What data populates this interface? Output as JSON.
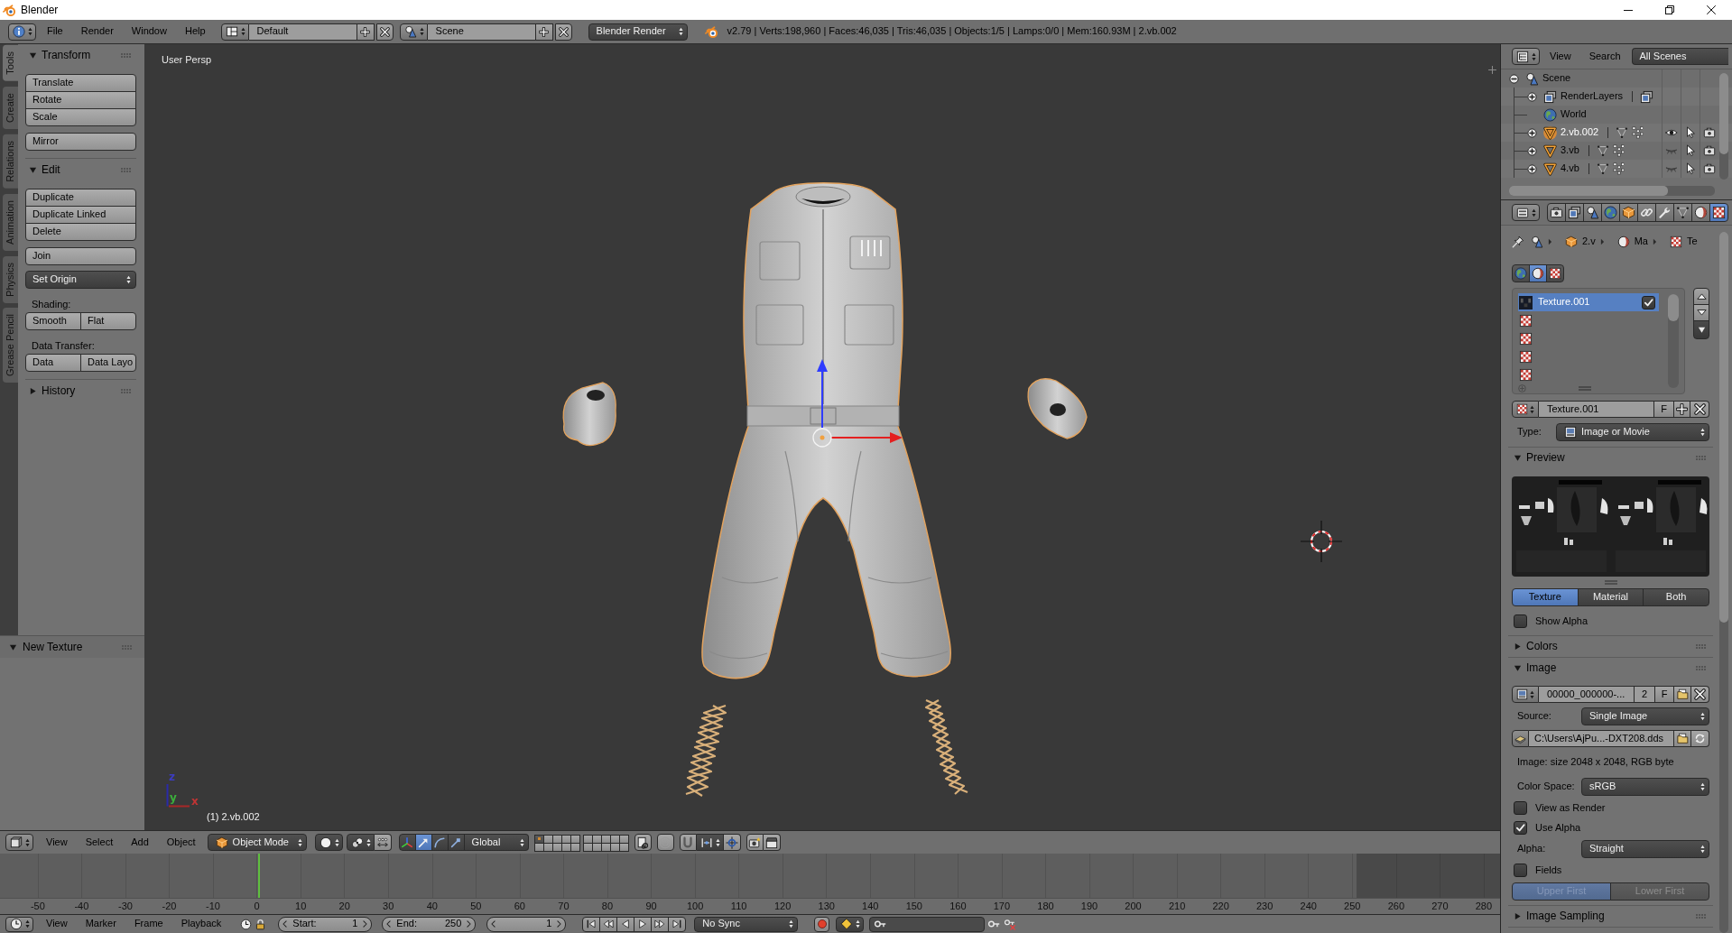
{
  "title_bar": {
    "title": "Blender"
  },
  "info_header": {
    "menus": [
      "File",
      "Render",
      "Window",
      "Help"
    ],
    "layout": "Default",
    "scene": "Scene",
    "engine": "Blender Render",
    "stats": "v2.79 | Verts:198,960 | Faces:46,035 | Tris:46,035 | Objects:1/5 | Lamps:0/0 | Mem:160.93M | 2.vb.002"
  },
  "tool_tabs": [
    {
      "label": "Tools",
      "selected": true
    },
    {
      "label": "Create",
      "selected": false
    },
    {
      "label": "Relations",
      "selected": false
    },
    {
      "label": "Animation",
      "selected": false
    },
    {
      "label": "Physics",
      "selected": false
    },
    {
      "label": "Grease Pencil",
      "selected": false
    }
  ],
  "tool_panels": [
    {
      "title": "Transform",
      "expanded": true,
      "items": [
        {
          "kind": "stack",
          "buttons": [
            "Translate",
            "Rotate",
            "Scale"
          ]
        },
        {
          "kind": "button",
          "label": "Mirror"
        }
      ]
    },
    {
      "title": "Edit",
      "expanded": true,
      "items": [
        {
          "kind": "stack",
          "buttons": [
            "Duplicate",
            "Duplicate Linked",
            "Delete"
          ]
        },
        {
          "kind": "button",
          "label": "Join"
        },
        {
          "kind": "dropdown",
          "label": "Set Origin"
        },
        {
          "kind": "label",
          "label": "Shading:"
        },
        {
          "kind": "row",
          "buttons": [
            "Smooth",
            "Flat"
          ]
        },
        {
          "kind": "label",
          "label": "Data Transfer:"
        },
        {
          "kind": "row",
          "buttons": [
            "Data",
            "Data Layo"
          ]
        }
      ]
    },
    {
      "title": "History",
      "expanded": false
    }
  ],
  "redo_panel": {
    "title": "New Texture",
    "expanded": true
  },
  "viewport": {
    "view_name": "User Persp",
    "object_info": "(1) 2.vb.002",
    "axis_labels": [
      {
        "label": "z",
        "color": "#3c3cc0"
      },
      {
        "label": "y",
        "color": "#3cb03c"
      },
      {
        "label": "x",
        "color": "#c03434"
      }
    ]
  },
  "view3d_header": {
    "menus": [
      "View",
      "Select",
      "Add",
      "Object"
    ],
    "mode": "Object Mode",
    "manipulators": [
      {
        "kind": "axes",
        "selected": false
      },
      {
        "kind": "translate",
        "selected": true
      },
      {
        "kind": "rotate",
        "selected": false
      },
      {
        "kind": "scale",
        "selected": false
      }
    ],
    "orientation": "Global",
    "layers": [
      {
        "selected": true,
        "has_objects": true
      },
      {
        "selected": false,
        "has_objects": false
      },
      {
        "selected": false,
        "has_objects": false
      },
      {
        "selected": false,
        "has_objects": false
      },
      {
        "selected": false,
        "has_objects": false
      },
      {
        "selected": false,
        "has_objects": false
      },
      {
        "selected": false,
        "has_objects": false
      },
      {
        "selected": false,
        "has_objects": false
      },
      {
        "selected": false,
        "has_objects": false
      },
      {
        "selected": false,
        "has_objects": false
      },
      {
        "selected": false,
        "has_objects": false
      },
      {
        "selected": false,
        "has_objects": false
      },
      {
        "selected": false,
        "has_objects": false
      },
      {
        "selected": false,
        "has_objects": false
      },
      {
        "selected": false,
        "has_objects": false
      },
      {
        "selected": false,
        "has_objects": false
      },
      {
        "selected": false,
        "has_objects": false
      },
      {
        "selected": false,
        "has_objects": false
      },
      {
        "selected": false,
        "has_objects": false
      },
      {
        "selected": false,
        "has_objects": false
      }
    ]
  },
  "timeline": {
    "ruler": [
      "-50",
      "-40",
      "-30",
      "-20",
      "-10",
      "0",
      "10",
      "20",
      "30",
      "40",
      "50",
      "60",
      "70",
      "80",
      "90",
      "100",
      "110",
      "120",
      "130",
      "140",
      "150",
      "160",
      "170",
      "180",
      "190",
      "200",
      "210",
      "220",
      "230",
      "240",
      "250",
      "260",
      "270",
      "280"
    ]
  },
  "timeline_header": {
    "menus": [
      "View",
      "Marker",
      "Frame",
      "Playback"
    ],
    "start_label": "Start:",
    "start": "1",
    "end_label": "End:",
    "end": "250",
    "current": "1",
    "sync": "No Sync"
  },
  "outliner": {
    "menus": [
      "View",
      "Search"
    ],
    "display": "All Scenes",
    "tree": [
      {
        "label": "Scene",
        "kind": "scene",
        "expanded": true,
        "selected": false,
        "children": [
          {
            "label": "RenderLayers",
            "kind": "render_layers",
            "expanded": false,
            "selected": false
          },
          {
            "label": "World",
            "kind": "world",
            "selected": false
          },
          {
            "label": "2.vb.002",
            "kind": "mesh",
            "expanded": false,
            "selected": true,
            "visible": true
          },
          {
            "label": "3.vb",
            "kind": "mesh",
            "expanded": false,
            "selected": false,
            "visible": false
          },
          {
            "label": "4.vb",
            "kind": "mesh",
            "expanded": false,
            "selected": false,
            "visible": false
          }
        ]
      }
    ]
  },
  "properties": {
    "tabs": [
      {
        "kind": "render",
        "selected": false
      },
      {
        "kind": "render_layers",
        "selected": false
      },
      {
        "kind": "scene",
        "selected": false
      },
      {
        "kind": "world",
        "selected": false
      },
      {
        "kind": "object",
        "selected": false
      },
      {
        "kind": "constraints",
        "selected": false
      },
      {
        "kind": "modifiers",
        "selected": false
      },
      {
        "kind": "data",
        "selected": false
      },
      {
        "kind": "material",
        "selected": false
      },
      {
        "kind": "texture",
        "selected": true
      }
    ],
    "breadcrumb": [
      {
        "kind": "scene"
      },
      {
        "kind": "object",
        "label": "2.v"
      },
      {
        "kind": "material",
        "label": "Ma"
      },
      {
        "kind": "texture",
        "label": "Te"
      }
    ],
    "texture_context": [
      {
        "kind": "world",
        "selected": false
      },
      {
        "kind": "material",
        "selected": true
      },
      {
        "kind": "other",
        "selected": false
      }
    ],
    "texture_slots": [
      {
        "kind": "texture",
        "label": "Texture.001",
        "selected": true,
        "checked": true
      },
      {
        "kind": "empty",
        "selected": false
      },
      {
        "kind": "empty",
        "selected": false
      },
      {
        "kind": "empty",
        "selected": false
      },
      {
        "kind": "empty",
        "selected": false
      }
    ],
    "texture_id": {
      "name": "Texture.001",
      "fake_user": "F"
    },
    "type": {
      "label": "Type:",
      "value": "Image or Movie"
    },
    "panels": [
      {
        "title": "Preview",
        "expanded": true,
        "modes": [
          {
            "label": "Texture",
            "selected": true
          },
          {
            "label": "Material",
            "selected": false
          },
          {
            "label": "Both",
            "selected": false
          }
        ],
        "show_alpha": {
          "label": "Show Alpha",
          "checked": false
        }
      },
      {
        "title": "Colors",
        "expanded": false
      },
      {
        "title": "Image",
        "expanded": true,
        "rows": [
          {
            "kind": "image_id",
            "name": "00000_000000-...",
            "users": "2",
            "fake_user": "F"
          },
          {
            "kind": "select",
            "label": "Source:",
            "value": "Single Image"
          },
          {
            "kind": "filepath",
            "value": "C:\\Users\\AjPu...-DXT208.dds"
          },
          {
            "kind": "info",
            "text": "Image: size 2048 x 2048, RGB byte"
          },
          {
            "kind": "select",
            "label": "Color Space:",
            "value": "sRGB"
          },
          {
            "kind": "checkbox",
            "label": "View as Render",
            "checked": false
          },
          {
            "kind": "checkbox",
            "label": "Use Alpha",
            "checked": true
          },
          {
            "kind": "select",
            "label": "Alpha:",
            "value": "Straight"
          },
          {
            "kind": "checkbox",
            "label": "Fields",
            "checked": false
          },
          {
            "kind": "segmented",
            "disabled": true,
            "options": [
              {
                "label": "Upper First",
                "selected": true
              },
              {
                "label": "Lower First",
                "selected": false
              }
            ]
          }
        ]
      },
      {
        "title": "Image Sampling",
        "expanded": false
      }
    ]
  }
}
